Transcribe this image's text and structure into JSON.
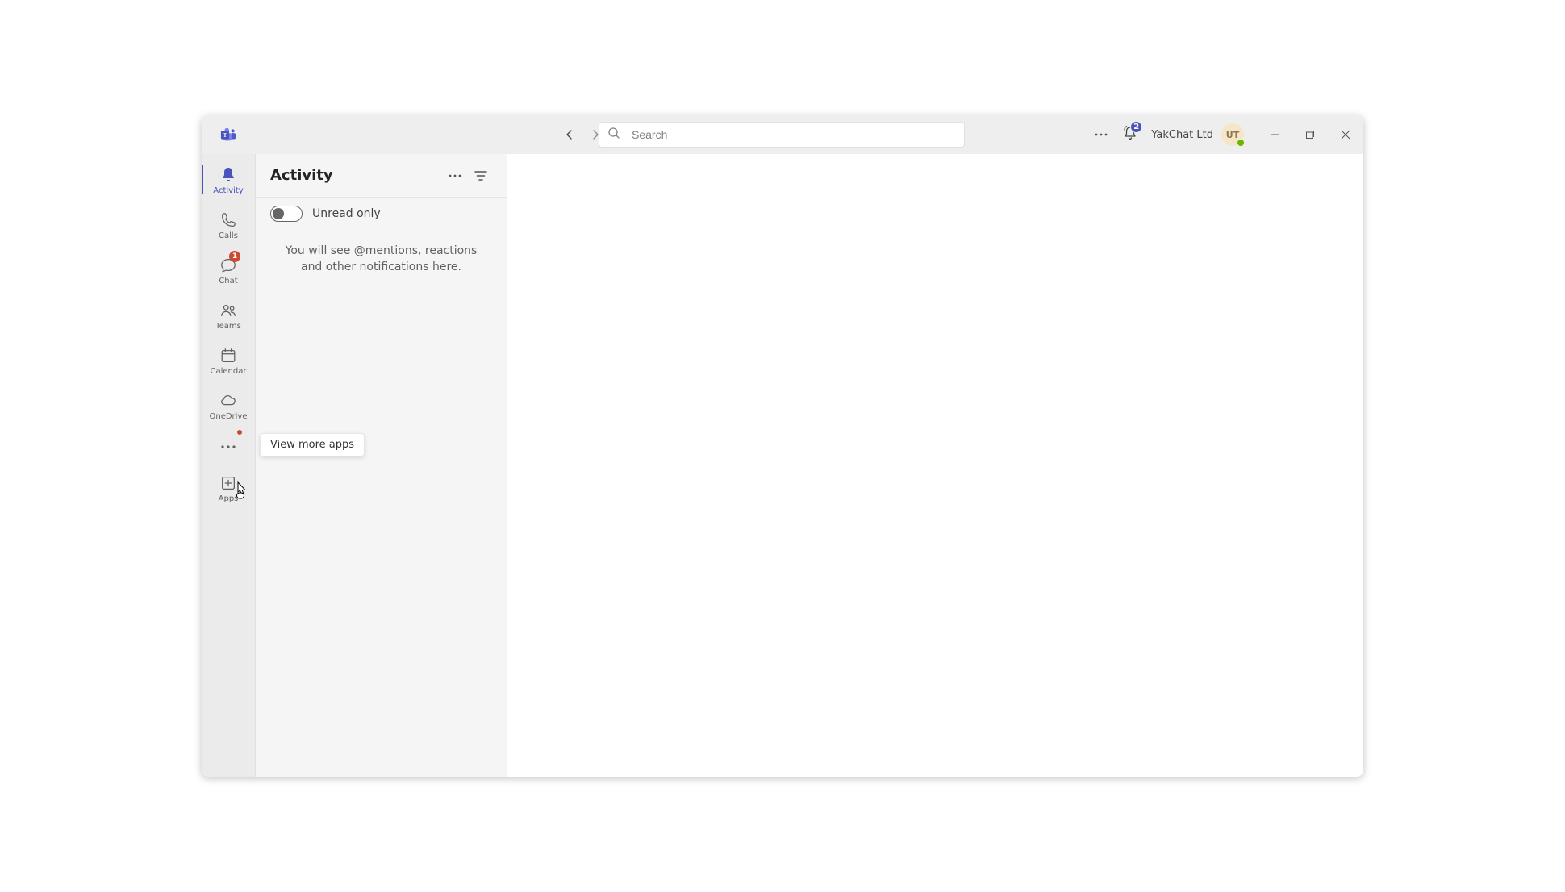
{
  "titlebar": {
    "search_placeholder": "Search",
    "org_name": "YakChat Ltd",
    "avatar_initials": "UT",
    "notification_count": "2"
  },
  "rail": {
    "items": [
      {
        "id": "activity",
        "label": "Activity",
        "active": true
      },
      {
        "id": "calls",
        "label": "Calls"
      },
      {
        "id": "chat",
        "label": "Chat",
        "badge": "1"
      },
      {
        "id": "teams",
        "label": "Teams"
      },
      {
        "id": "calendar",
        "label": "Calendar"
      },
      {
        "id": "onedrive",
        "label": "OneDrive"
      }
    ],
    "more_tooltip": "View more apps",
    "apps_label": "Apps"
  },
  "activity": {
    "title": "Activity",
    "unread_label": "Unread only",
    "empty_message": "You will see @mentions, reactions and other notifications here."
  }
}
